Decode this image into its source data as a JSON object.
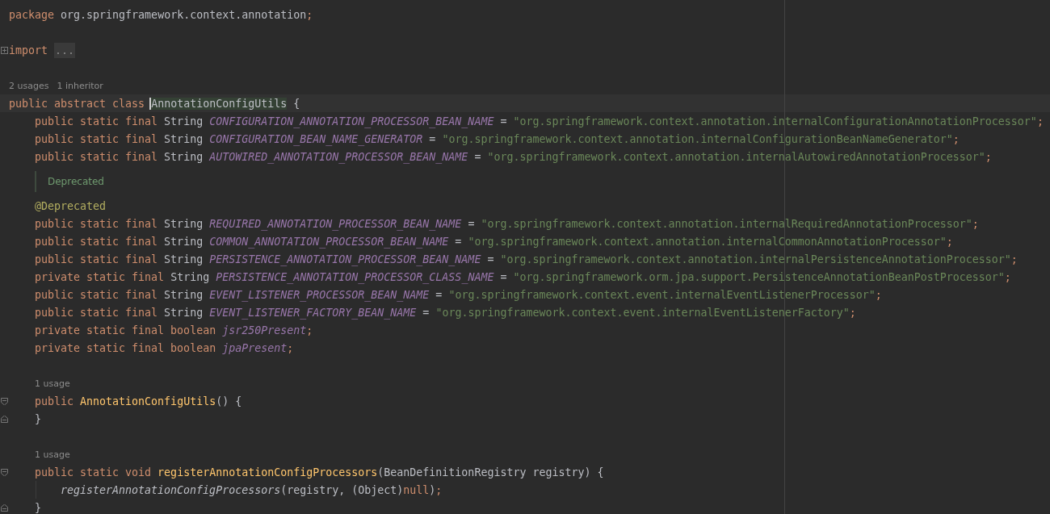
{
  "editor": {
    "lines": [
      {
        "kind": "code",
        "tokens": [
          {
            "kind": "kw",
            "t": "package "
          },
          {
            "kind": "plain",
            "t": "org.springframework.context.annotation"
          },
          {
            "kind": "kw",
            "t": ";"
          }
        ]
      },
      {
        "kind": "blank"
      },
      {
        "kind": "code",
        "fold": {
          "kind": "collapsed"
        },
        "tokens": [
          {
            "kind": "kw",
            "t": "import "
          },
          {
            "kind": "folded",
            "t": "..."
          }
        ]
      },
      {
        "kind": "blank"
      },
      {
        "kind": "hints",
        "items": [
          "2 usages",
          "1 inheritor"
        ]
      },
      {
        "kind": "code",
        "current": true,
        "tokens": [
          {
            "kind": "kw",
            "t": "public abstract class "
          },
          {
            "kind": "plain",
            "t": "AnnotationConfigUtils",
            "caret": true
          },
          {
            "kind": "plain",
            "t": " {"
          }
        ],
        "children": [
          {
            "kind": "code",
            "tokens": [
              {
                "kind": "kw",
                "t": "public static final "
              },
              {
                "kind": "plain",
                "t": "String "
              },
              {
                "kind": "const",
                "t": "CONFIGURATION_ANNOTATION_PROCESSOR_BEAN_NAME"
              },
              {
                "kind": "plain",
                "t": " = "
              },
              {
                "kind": "str",
                "t": "\"org.springframework.context.annotation.internalConfigurationAnnotationProcessor\""
              },
              {
                "kind": "kw",
                "t": ";"
              }
            ]
          },
          {
            "kind": "code",
            "tokens": [
              {
                "kind": "kw",
                "t": "public static final "
              },
              {
                "kind": "plain",
                "t": "String "
              },
              {
                "kind": "const",
                "t": "CONFIGURATION_BEAN_NAME_GENERATOR"
              },
              {
                "kind": "plain",
                "t": " = "
              },
              {
                "kind": "str",
                "t": "\"org.springframework.context.annotation.internalConfigurationBeanNameGenerator\""
              },
              {
                "kind": "kw",
                "t": ";"
              }
            ]
          },
          {
            "kind": "code",
            "tokens": [
              {
                "kind": "kw",
                "t": "public static final "
              },
              {
                "kind": "plain",
                "t": "String "
              },
              {
                "kind": "const",
                "t": "AUTOWIRED_ANNOTATION_PROCESSOR_BEAN_NAME"
              },
              {
                "kind": "plain",
                "t": " = "
              },
              {
                "kind": "str",
                "t": "\"org.springframework.context.annotation.internalAutowiredAnnotationProcessor\""
              },
              {
                "kind": "kw",
                "t": ";"
              }
            ]
          },
          {
            "kind": "doc",
            "text": "Deprecated"
          },
          {
            "kind": "code",
            "tokens": [
              {
                "kind": "ann",
                "t": "@Deprecated"
              }
            ]
          },
          {
            "kind": "code",
            "tokens": [
              {
                "kind": "kw",
                "t": "public static final "
              },
              {
                "kind": "plain",
                "t": "String "
              },
              {
                "kind": "const",
                "t": "REQUIRED_ANNOTATION_PROCESSOR_BEAN_NAME"
              },
              {
                "kind": "plain",
                "t": " = "
              },
              {
                "kind": "str",
                "t": "\"org.springframework.context.annotation.internalRequiredAnnotationProcessor\""
              },
              {
                "kind": "kw",
                "t": ";"
              }
            ]
          },
          {
            "kind": "code",
            "tokens": [
              {
                "kind": "kw",
                "t": "public static final "
              },
              {
                "kind": "plain",
                "t": "String "
              },
              {
                "kind": "const",
                "t": "COMMON_ANNOTATION_PROCESSOR_BEAN_NAME"
              },
              {
                "kind": "plain",
                "t": " = "
              },
              {
                "kind": "str",
                "t": "\"org.springframework.context.annotation.internalCommonAnnotationProcessor\""
              },
              {
                "kind": "kw",
                "t": ";"
              }
            ]
          },
          {
            "kind": "code",
            "tokens": [
              {
                "kind": "kw",
                "t": "public static final "
              },
              {
                "kind": "plain",
                "t": "String "
              },
              {
                "kind": "const",
                "t": "PERSISTENCE_ANNOTATION_PROCESSOR_BEAN_NAME"
              },
              {
                "kind": "plain",
                "t": " = "
              },
              {
                "kind": "str",
                "t": "\"org.springframework.context.annotation.internalPersistenceAnnotationProcessor\""
              },
              {
                "kind": "kw",
                "t": ";"
              }
            ]
          },
          {
            "kind": "code",
            "tokens": [
              {
                "kind": "kw",
                "t": "private static final "
              },
              {
                "kind": "plain",
                "t": "String "
              },
              {
                "kind": "const",
                "t": "PERSISTENCE_ANNOTATION_PROCESSOR_CLASS_NAME"
              },
              {
                "kind": "plain",
                "t": " = "
              },
              {
                "kind": "str",
                "t": "\"org.springframework.orm.jpa.support.PersistenceAnnotationBeanPostProcessor\""
              },
              {
                "kind": "kw",
                "t": ";"
              }
            ]
          },
          {
            "kind": "code",
            "tokens": [
              {
                "kind": "kw",
                "t": "public static final "
              },
              {
                "kind": "plain",
                "t": "String "
              },
              {
                "kind": "const",
                "t": "EVENT_LISTENER_PROCESSOR_BEAN_NAME"
              },
              {
                "kind": "plain",
                "t": " = "
              },
              {
                "kind": "str",
                "t": "\"org.springframework.context.event.internalEventListenerProcessor\""
              },
              {
                "kind": "kw",
                "t": ";"
              }
            ]
          },
          {
            "kind": "code",
            "tokens": [
              {
                "kind": "kw",
                "t": "public static final "
              },
              {
                "kind": "plain",
                "t": "String "
              },
              {
                "kind": "const",
                "t": "EVENT_LISTENER_FACTORY_BEAN_NAME"
              },
              {
                "kind": "plain",
                "t": " = "
              },
              {
                "kind": "str",
                "t": "\"org.springframework.context.event.internalEventListenerFactory\""
              },
              {
                "kind": "kw",
                "t": ";"
              }
            ]
          },
          {
            "kind": "code",
            "tokens": [
              {
                "kind": "kw",
                "t": "private static final boolean "
              },
              {
                "kind": "const",
                "t": "jsr250Present"
              },
              {
                "kind": "kw",
                "t": ";"
              }
            ]
          },
          {
            "kind": "code",
            "tokens": [
              {
                "kind": "kw",
                "t": "private static final boolean "
              },
              {
                "kind": "const",
                "t": "jpaPresent"
              },
              {
                "kind": "kw",
                "t": ";"
              }
            ]
          },
          {
            "kind": "blank"
          },
          {
            "kind": "hints",
            "items": [
              "1 usage"
            ]
          },
          {
            "kind": "code",
            "fold": {
              "kind": "expanded"
            },
            "tokens": [
              {
                "kind": "kw",
                "t": "public "
              },
              {
                "kind": "decl",
                "t": "AnnotationConfigUtils"
              },
              {
                "kind": "plain",
                "t": "() {"
              }
            ]
          },
          {
            "kind": "code",
            "fold": {
              "kind": "end"
            },
            "tokens": [
              {
                "kind": "plain",
                "t": "}"
              }
            ]
          },
          {
            "kind": "blank"
          },
          {
            "kind": "hints",
            "items": [
              "1 usage"
            ]
          },
          {
            "kind": "code",
            "fold": {
              "kind": "expanded"
            },
            "tokens": [
              {
                "kind": "kw",
                "t": "public static void "
              },
              {
                "kind": "decl",
                "t": "registerAnnotationConfigProcessors"
              },
              {
                "kind": "plain",
                "t": "(BeanDefinitionRegistry registry) {"
              }
            ],
            "children": [
              {
                "kind": "code",
                "tokens": [
                  {
                    "kind": "call",
                    "t": "registerAnnotationConfigProcessors"
                  },
                  {
                    "kind": "plain",
                    "t": "(registry, (Object)"
                  },
                  {
                    "kind": "kw",
                    "t": "null"
                  },
                  {
                    "kind": "plain",
                    "t": ")"
                  },
                  {
                    "kind": "kw",
                    "t": ";"
                  }
                ]
              }
            ]
          },
          {
            "kind": "code",
            "fold": {
              "kind": "end"
            },
            "tokens": [
              {
                "kind": "plain",
                "t": "}"
              }
            ]
          }
        ]
      }
    ]
  }
}
